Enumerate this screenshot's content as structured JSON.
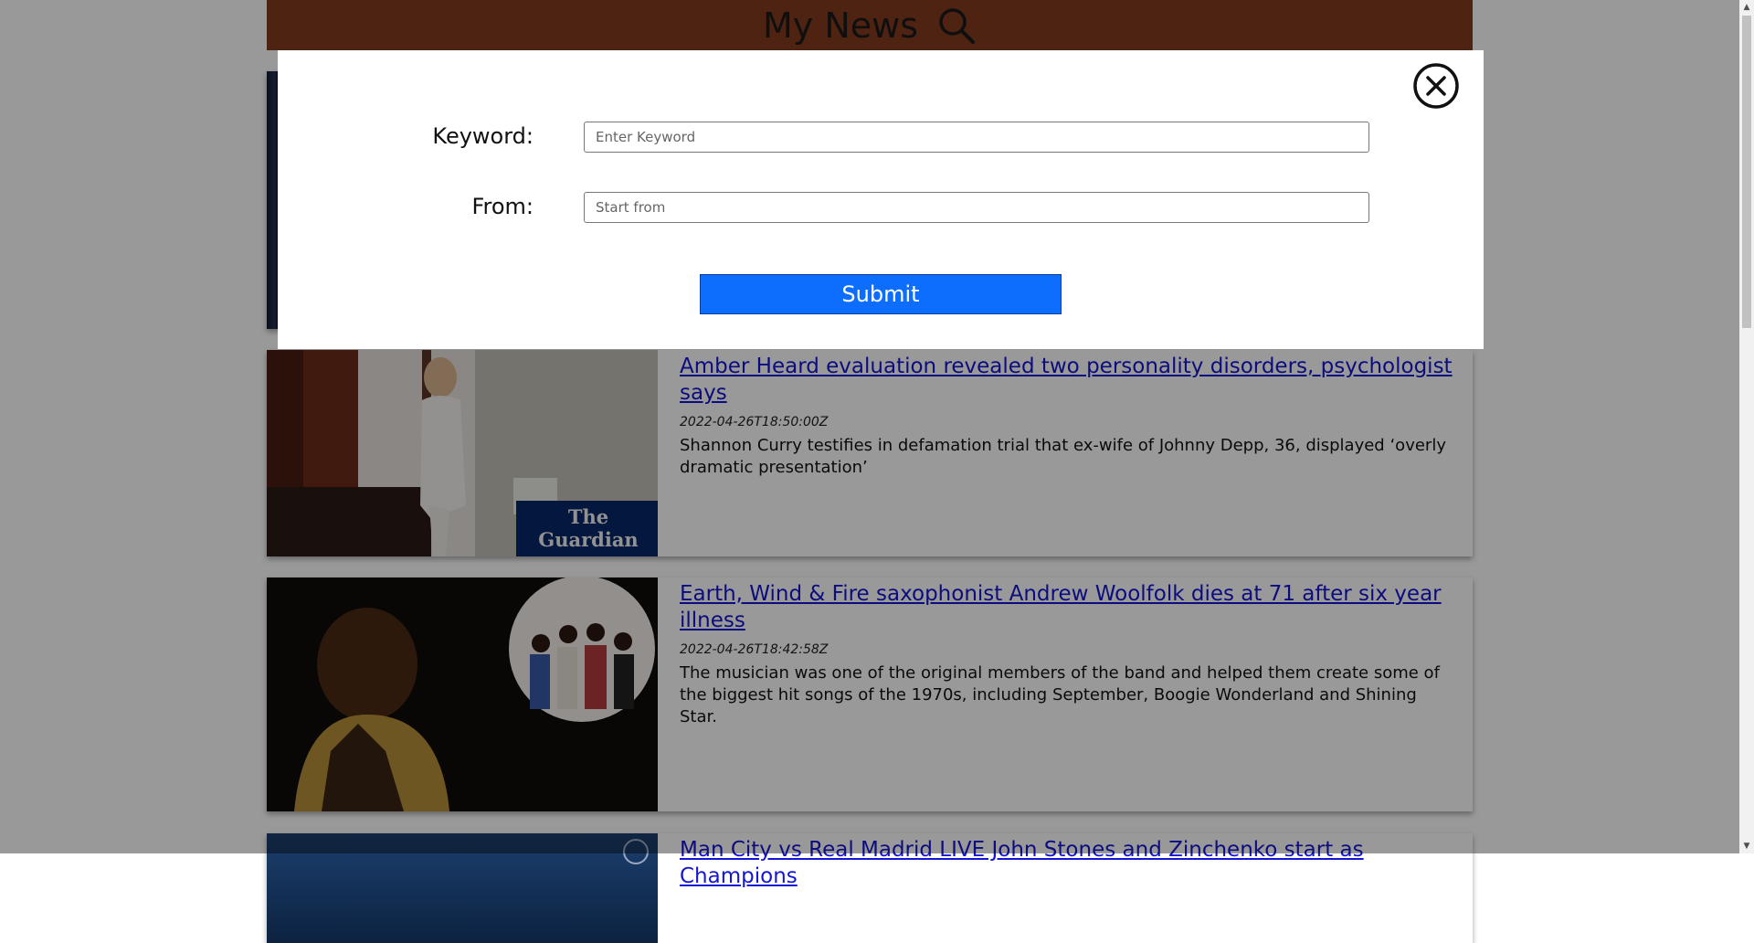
{
  "header": {
    "title": "My News",
    "search_icon": "search-icon"
  },
  "modal": {
    "close_icon": "close-circle-icon",
    "keyword_label": "Keyword:",
    "keyword_placeholder": "Enter Keyword",
    "keyword_value": "",
    "from_label": "From:",
    "from_placeholder": "Start from",
    "from_value": "",
    "submit_label": "Submit"
  },
  "articles": [
    {
      "title": "Amber Heard evaluation revealed two personality disorders, psychologist says",
      "date": "2022-04-26T18:50:00Z",
      "description": "Shannon Curry testifies in defamation trial that ex-wife of Johnny Depp, 36, displayed ‘overly dramatic presentation’",
      "image_badge": "The Guardian"
    },
    {
      "title": "Earth, Wind & Fire saxophonist Andrew Woolfolk dies at 71 after six year illness",
      "date": "2022-04-26T18:42:58Z",
      "description": "The musician was one of the original members of the band and helped them create some of the biggest hit songs of the 1970s, including September, Boogie Wonderland and Shining Star."
    },
    {
      "title": "Man City vs Real Madrid LIVE John Stones and Zinchenko start as Champions"
    }
  ],
  "colors": {
    "header_bg": "#843b1e",
    "link": "#1515d4",
    "submit_bg": "#0d6efd"
  }
}
